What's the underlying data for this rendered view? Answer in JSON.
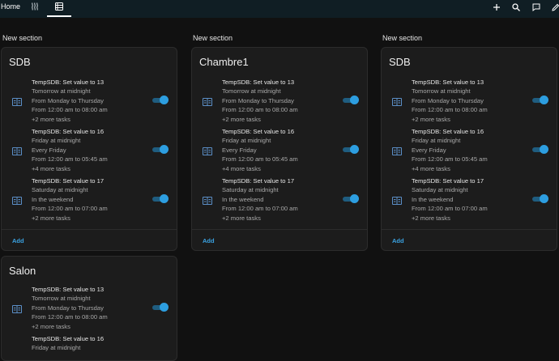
{
  "top_bar": {
    "home_tab_label": "Home",
    "icons": [
      "heat-waves-icon",
      "schedule-list-icon"
    ],
    "actions": [
      "plus-icon",
      "search-icon",
      "chat-icon",
      "pencil-icon"
    ],
    "bg_color": "#101e24"
  },
  "sections": [
    {
      "section_title": "New section",
      "card_title": "SDB",
      "add_label": "Add",
      "tasks": [
        {
          "title": "TempSDB: Set value to 13",
          "when": "Tomorrow at midnight",
          "days": "From Monday to Thursday",
          "hours": "From 12:00 am to 08:00 am",
          "more": "+2 more tasks"
        },
        {
          "title": "TempSDB: Set value to 16",
          "when": "Friday at midnight",
          "days": "Every Friday",
          "hours": "From 12:00 am to 05:45 am",
          "more": "+4 more tasks"
        },
        {
          "title": "TempSDB: Set value to 17",
          "when": "Saturday at midnight",
          "days": "In the weekend",
          "hours": "From 12:00 am to 07:00 am",
          "more": "+2 more tasks"
        }
      ]
    },
    {
      "section_title": "New section",
      "card_title": "Chambre1",
      "add_label": "Add",
      "tasks": [
        {
          "title": "TempSDB: Set value to 13",
          "when": "Tomorrow at midnight",
          "days": "From Monday to Thursday",
          "hours": "From 12:00 am to 08:00 am",
          "more": "+2 more tasks"
        },
        {
          "title": "TempSDB: Set value to 16",
          "when": "Friday at midnight",
          "days": "Every Friday",
          "hours": "From 12:00 am to 05:45 am",
          "more": "+4 more tasks"
        },
        {
          "title": "TempSDB: Set value to 17",
          "when": "Saturday at midnight",
          "days": "In the weekend",
          "hours": "From 12:00 am to 07:00 am",
          "more": "+2 more tasks"
        }
      ]
    },
    {
      "section_title": "New section",
      "card_title": "SDB",
      "add_label": "Add",
      "tasks": [
        {
          "title": "TempSDB: Set value to 13",
          "when": "Tomorrow at midnight",
          "days": "From Monday to Thursday",
          "hours": "From 12:00 am to 08:00 am",
          "more": "+2 more tasks"
        },
        {
          "title": "TempSDB: Set value to 16",
          "when": "Friday at midnight",
          "days": "Every Friday",
          "hours": "From 12:00 am to 05:45 am",
          "more": "+4 more tasks"
        },
        {
          "title": "TempSDB: Set value to 17",
          "when": "Saturday at midnight",
          "days": "In the weekend",
          "hours": "From 12:00 am to 07:00 am",
          "more": "+2 more tasks"
        }
      ]
    }
  ],
  "salon_card": {
    "card_title": "Salon",
    "tasks": [
      {
        "title": "TempSDB: Set value to 13",
        "when": "Tomorrow at midnight",
        "days": "From Monday to Thursday",
        "hours": "From 12:00 am to 08:00 am",
        "more": "+2 more tasks"
      },
      {
        "title": "TempSDB: Set value to 16",
        "when": "Friday at midnight"
      }
    ]
  },
  "colors": {
    "accent": "#2d9ee0",
    "card_bg": "#1c1c1c",
    "page_bg": "#111111"
  }
}
